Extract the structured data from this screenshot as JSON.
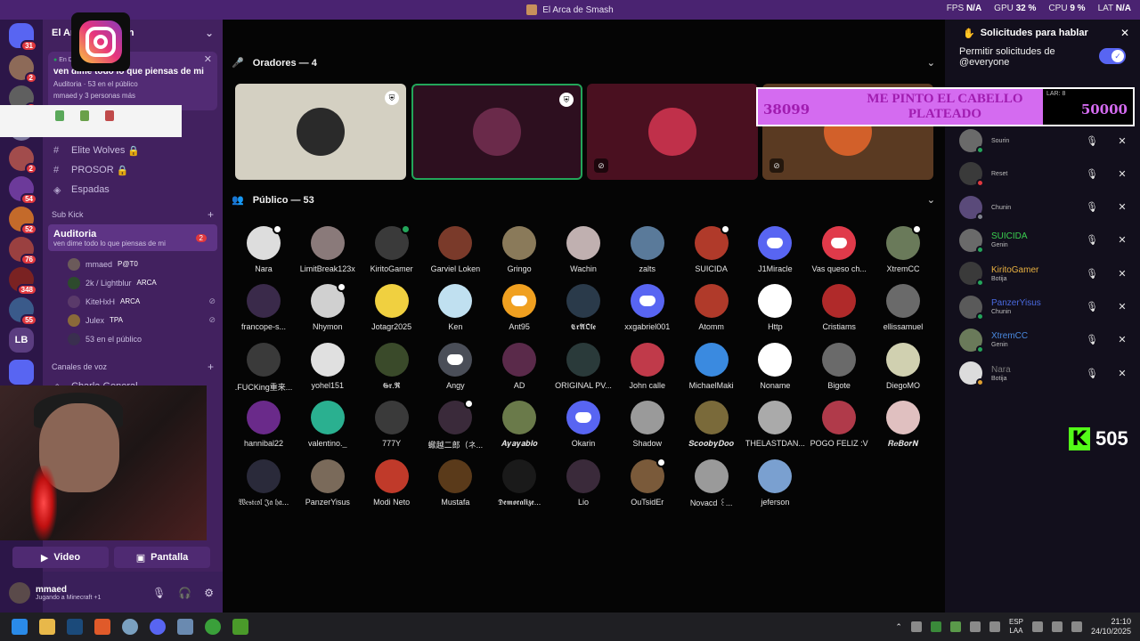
{
  "window": {
    "title": "El Arca de Smash"
  },
  "perf": [
    {
      "label": "FPS",
      "value": "N/A"
    },
    {
      "label": "GPU",
      "value": "32 %"
    },
    {
      "label": "CPU",
      "value": "9 %"
    },
    {
      "label": "LAT",
      "value": "N/A"
    }
  ],
  "rail": {
    "badges": [
      "31",
      "2",
      "5",
      "2",
      "54",
      "52",
      "76",
      "348",
      "55"
    ],
    "lb_label": "LB"
  },
  "sidebar": {
    "server_name": "El Arca de Smash",
    "notice": {
      "live": "En D",
      "message": "ven dime todo lo que piensas de mi",
      "meta": "Auditoria · 53 en el público",
      "sub": "mmaed y 3 personas más"
    },
    "channels_top": [
      {
        "name": "Elite Wolves",
        "locked": "🔒"
      },
      {
        "name": "PROSOR",
        "locked": "🔒"
      },
      {
        "name": "Espadas",
        "locked": ""
      }
    ],
    "cat_subkick": "Sub Kick",
    "active_channel": {
      "name": "Auditoria",
      "topic": "ven dime todo lo que piensas de mi",
      "badge": "2"
    },
    "voice_users": [
      {
        "name": "mmaed",
        "tag": "P@T0"
      },
      {
        "name": "2k / Lightblur",
        "tag": "ARCA"
      },
      {
        "name": "KiteHxH",
        "tag": "ARCA"
      },
      {
        "name": "Julex",
        "tag": "TPA"
      }
    ],
    "public_count": "53 en el público",
    "cat_voice": "Canales de voz",
    "charla": "Charla General"
  },
  "actions": {
    "video": "Video",
    "screen": "Pantalla"
  },
  "user": {
    "name": "mmaed",
    "status": "Jugando a Minecraft +1"
  },
  "stage": {
    "speakers_header": "Oradores — 4",
    "public_header": "Público — 53",
    "promo": {
      "left_number": "38099",
      "message": "ME PINTO EL CABELLO PLATEADO",
      "right_number": "50000",
      "lar": "LAR: 8"
    }
  },
  "audience": [
    "Nara",
    "LimitBreak123x",
    "KiritoGamer",
    "Garviel Loken",
    "Gringo",
    "Wachin",
    "zalts",
    "SUICIDA",
    "J1Miracle",
    "Vas queso ch...",
    "XtremCC",
    "francope-s...",
    "Nhymon",
    "Jotagr2025",
    "Ken",
    "Ant95",
    "𝕮𝖗𝕬𝕺𝖑𝖊",
    "xxgabriel001",
    "Atomm",
    "Http",
    "Cristiams",
    "ellissamuel",
    ".FUCKing重来...",
    "yohel151",
    "𝕲𝖗.𝕽",
    "Angy",
    "AD",
    "ORIGINAL PV...",
    "John calle",
    "MichaelMaki",
    "Noname",
    "Bigote",
    "DiegoMO",
    "hannibal22",
    "valentino._",
    "777Y",
    "蠍越二郎（ネ...",
    "𝑨𝒚𝒂𝒚𝒂𝒃𝒍𝒐",
    "Okarin",
    "Shadow",
    "𝑺𝒄𝒐𝒐𝒃𝒚𝑫𝒐𝒐",
    "THELASTDAN...",
    "POGO FELIZ :V",
    "𝑹𝒆𝑩𝒐𝒓𝑵",
    "𝔚𝔢𝔰𝔱𝔠𝔬𝔩 𝔍𝔞 𝔥𝔞...",
    "PanzerYisus",
    "Modi Neto",
    "Mustafa",
    "𝕯𝖊𝖒𝖔𝖗𝖆𝖑𝖎𝖟𝖊...",
    "Lio",
    "OuTsidEr",
    "Novacd ꒰...",
    "jeferson"
  ],
  "requests_panel": {
    "title": "Solicitudes para hablar",
    "permit_label": "Permitir solicitudes de @everyone",
    "items": [
      {
        "name": "",
        "role": "Sourin"
      },
      {
        "name": "",
        "role": "Reset"
      },
      {
        "name": "",
        "role": "Chunin"
      },
      {
        "name": "SUICIDA",
        "role": "Genin"
      },
      {
        "name": "KiritoGamer",
        "role": "Botija"
      },
      {
        "name": "PanzerYisus",
        "role": "Chunin"
      },
      {
        "name": "XtremCC",
        "role": "Genin"
      },
      {
        "name": "Nara",
        "role": "Botija"
      }
    ]
  },
  "kick": {
    "count": "505",
    "logo": "K"
  },
  "taskbar": {
    "lang1": "ESP",
    "lang2": "LAA",
    "time": "21:10",
    "date": "24/10/2025"
  }
}
